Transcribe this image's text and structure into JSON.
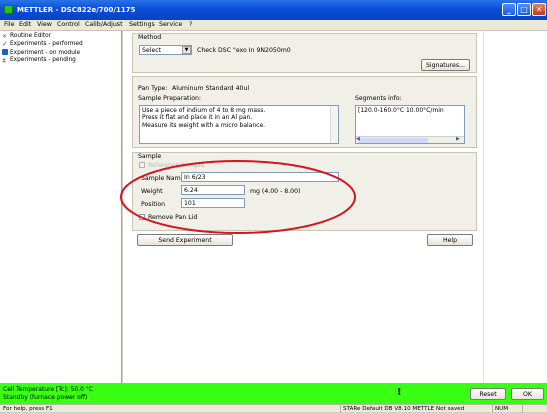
{
  "window": {
    "title": "METTLER - DSC822e/700/1175",
    "minimize": "_",
    "maximize": "□",
    "close": "✕"
  },
  "menu": [
    "File",
    "Edit",
    "View",
    "Control",
    "Calib/Adjust",
    "Settings",
    "Service",
    "?"
  ],
  "tree": [
    {
      "label": "Routine Editor",
      "icon": "wrench-icon",
      "color": "#c0392b"
    },
    {
      "label": "Experiments - performed",
      "icon": "checkmark-icon",
      "color": "#2e7d32"
    },
    {
      "label": "Experiment - on module",
      "icon": "module-icon",
      "color": "#1565c0"
    },
    {
      "label": "Experiments - pending",
      "icon": "hourglass-icon",
      "color": "#8d6e63"
    }
  ],
  "method": {
    "group_label": "Method",
    "select_value": "Select",
    "check_text": "Check DSC \"exo In 9N2050m0",
    "signatures_label": "Signatures..."
  },
  "pan": {
    "type_label": "Pan Type:",
    "type_value": "Aluminum Standard 40ul",
    "prep_label": "Sample Preparation:",
    "prep_text": "Use a piece of indium of 4 to 8 mg mass.\nPress it flat and place it in an Al pan.\nMeasure its weight with a micro balance.",
    "segments_label": "Segments info:",
    "segments_text": "[120.0-160.0°C 10.00°C/min"
  },
  "sample": {
    "group_label": "Sample",
    "faded_option": "Reference Sample",
    "name_label": "Sample Name",
    "name_value": "In 6/23",
    "weight_label": "Weight",
    "weight_value": "6.24",
    "weight_unit": "mg  (4.00 - 8.00)",
    "position_label": "Position",
    "position_value": "101",
    "remove_lid_label": "Remove Pan Lid"
  },
  "actions": {
    "send_label": "Send Experiment",
    "help_label": "Help"
  },
  "green_status": {
    "line1": "Cell Temperature [Tc]:   50.0 °C",
    "line2": "Standby (furnace power off)",
    "reset_label": "Reset",
    "ok_label": "OK"
  },
  "statusbar": {
    "hint": "For help, press F1",
    "info": "STARe Default DB V8.10 METTLE Not saved",
    "num": "NUM"
  },
  "colors": {
    "accent": "#0a4fd8",
    "highlight": "#d8141b",
    "status_green": "#39ff14"
  }
}
